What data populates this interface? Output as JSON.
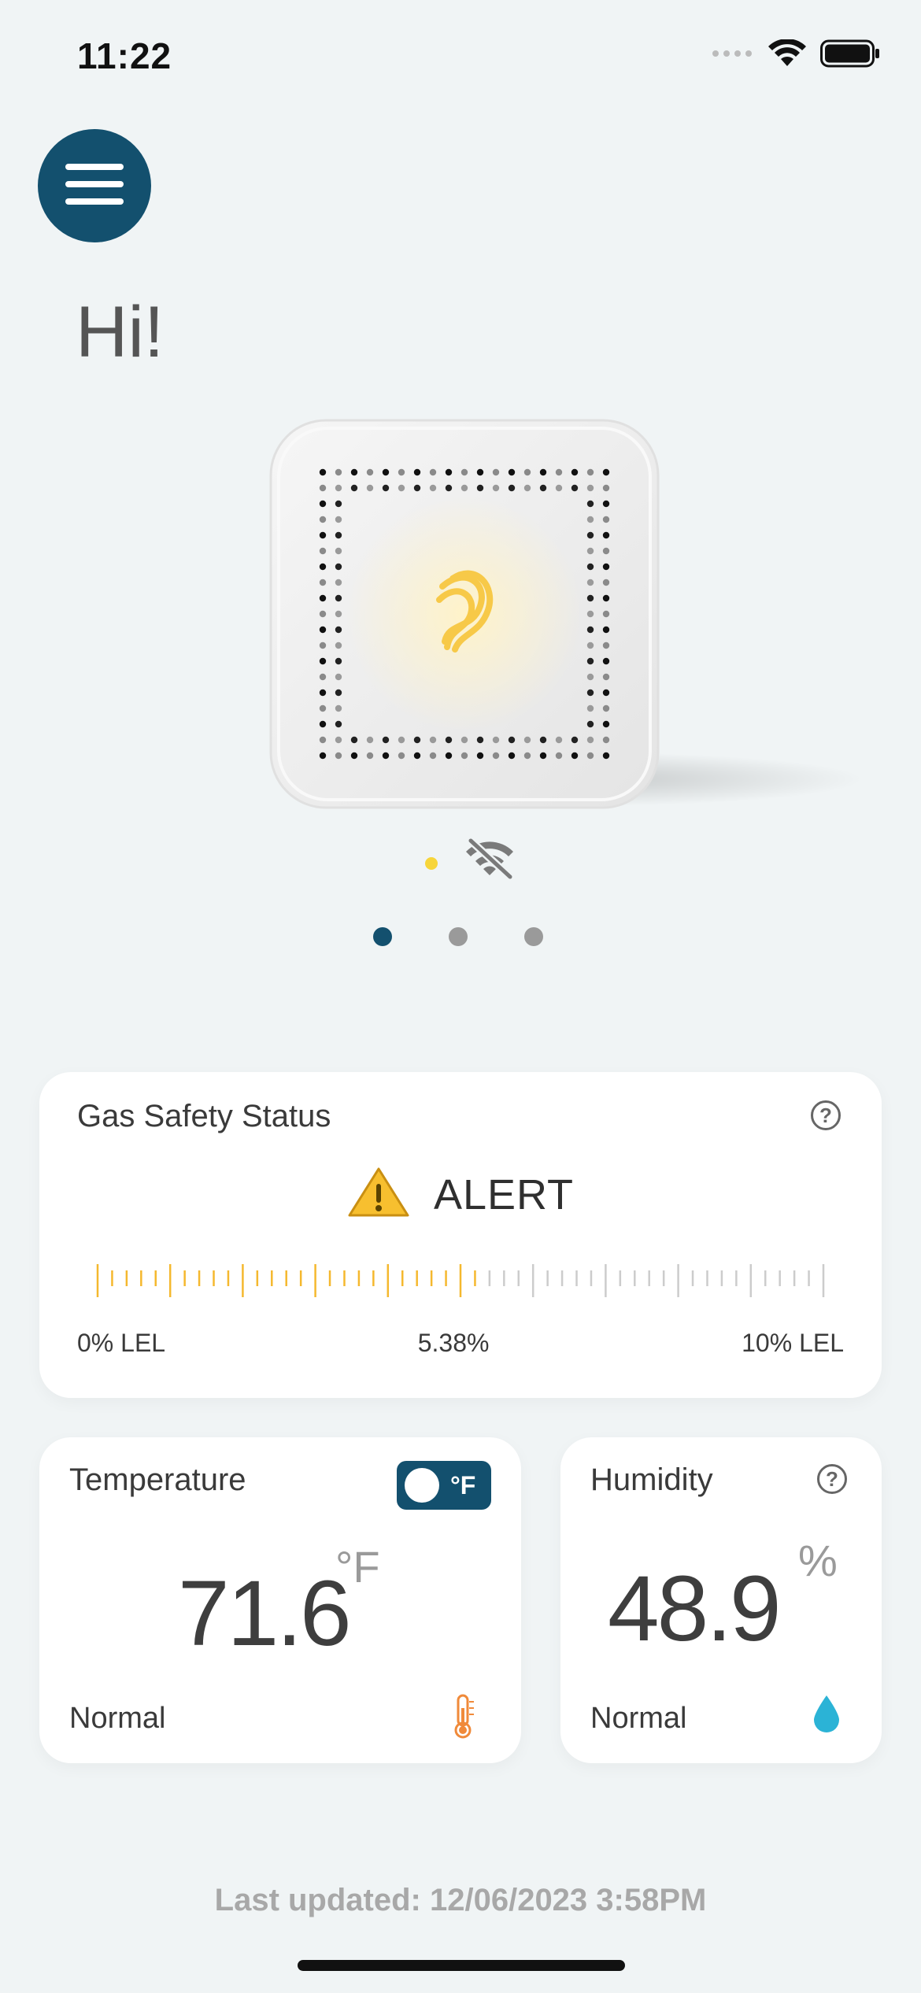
{
  "status_bar": {
    "time": "11:22"
  },
  "greeting": "Hi!",
  "device": {
    "connection": "wifi-off-icon",
    "pager_count": 3,
    "pager_active": 0
  },
  "gas_card": {
    "title": "Gas Safety Status",
    "status": "ALERT",
    "reading": "5.38%",
    "reading_value": 5.38,
    "scale_min_label": "0% LEL",
    "scale_max_label": "10% LEL",
    "scale_min": 0,
    "scale_max": 10
  },
  "temperature_card": {
    "title": "Temperature",
    "toggle_label": "°F",
    "value": "71.6",
    "unit": "°F",
    "status": "Normal"
  },
  "humidity_card": {
    "title": "Humidity",
    "value": "48.9",
    "unit": "%",
    "status": "Normal"
  },
  "footer": {
    "last_updated": "Last updated: 12/06/2023 3:58PM"
  },
  "colors": {
    "primary": "#13506e",
    "alert_yellow": "#f5b82e",
    "tick_inactive": "#cccccc",
    "thermometer": "#f08a3a",
    "water_drop": "#2bb3d6"
  }
}
